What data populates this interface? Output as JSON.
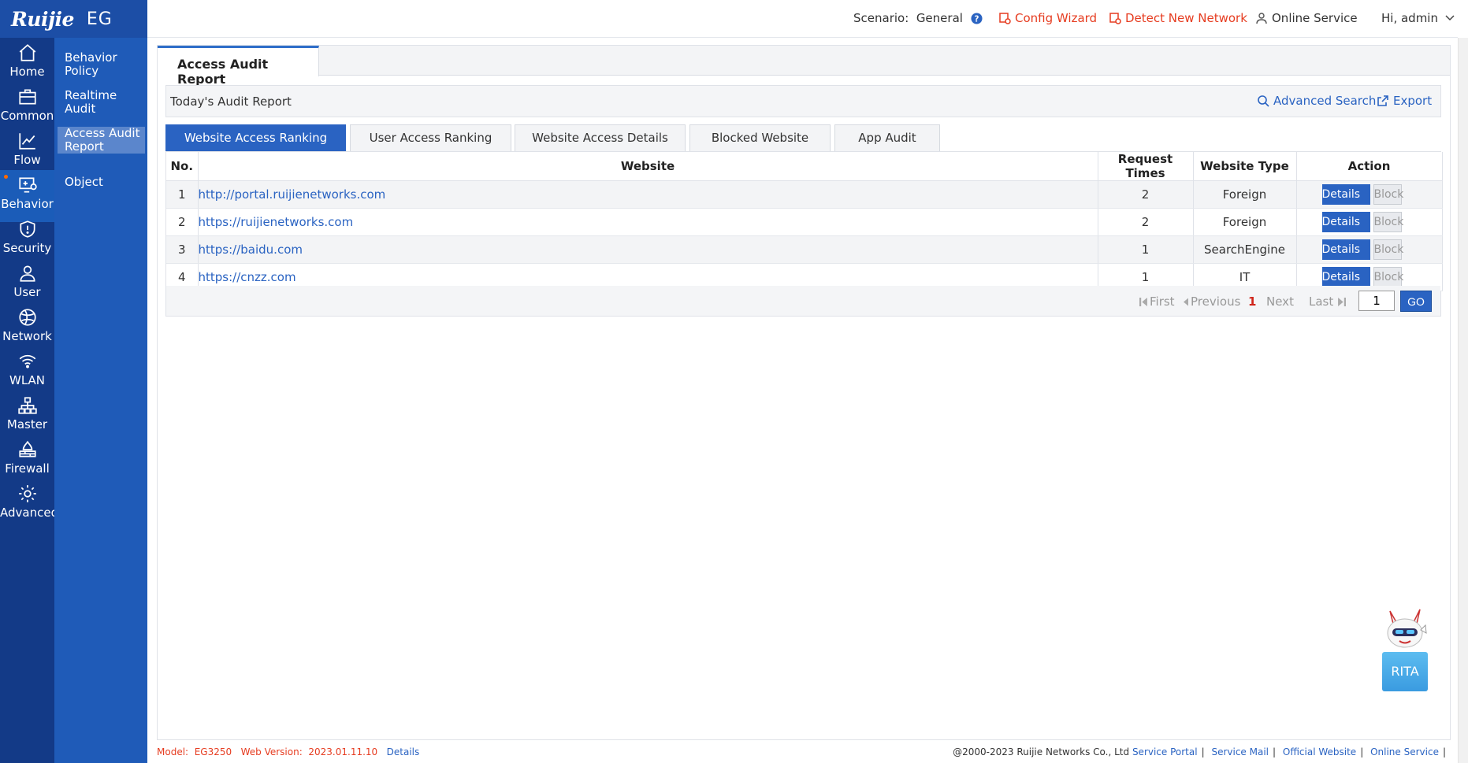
{
  "brand": {
    "logo": "Ruijie",
    "model": "EG"
  },
  "rail": [
    {
      "label": "Home",
      "icon": "home-icon"
    },
    {
      "label": "Common",
      "icon": "toolbox-icon"
    },
    {
      "label": "Flow",
      "icon": "chart-line-icon"
    },
    {
      "label": "Behavior",
      "icon": "monitor-person-icon"
    },
    {
      "label": "Security",
      "icon": "shield-icon"
    },
    {
      "label": "User",
      "icon": "user-icon"
    },
    {
      "label": "Network",
      "icon": "globe-icon"
    },
    {
      "label": "WLAN",
      "icon": "wifi-icon"
    },
    {
      "label": "Master",
      "icon": "hierarchy-icon"
    },
    {
      "label": "Firewall",
      "icon": "firewall-icon"
    },
    {
      "label": "Advanced",
      "icon": "gear-icon"
    }
  ],
  "submenu": [
    {
      "label": "Behavior Policy"
    },
    {
      "label": "Realtime Audit"
    },
    {
      "label": "Access Audit Report"
    },
    {
      "label": "Object"
    }
  ],
  "topbar": {
    "scenario_label": "Scenario:",
    "scenario_value": "General",
    "config_wizard": "Config Wizard",
    "detect_network": "Detect New Network",
    "online_service": "Online Service",
    "user_greeting": "Hi, admin"
  },
  "main_tab": "Access Audit Report",
  "report": {
    "title": "Today's Audit Report",
    "advanced_search": "Advanced Search",
    "export": "Export"
  },
  "subtabs": [
    {
      "label": "Website Access Ranking"
    },
    {
      "label": "User Access Ranking"
    },
    {
      "label": "Website Access Details"
    },
    {
      "label": "Blocked Website"
    },
    {
      "label": "App Audit"
    }
  ],
  "table": {
    "headers": {
      "no": "No.",
      "website": "Website",
      "requests": "Request Times",
      "type": "Website Type",
      "action": "Action"
    },
    "rows": [
      {
        "no": "1",
        "website": "http://portal.ruijienetworks.com",
        "requests": "2",
        "type": "Foreign"
      },
      {
        "no": "2",
        "website": "https://ruijienetworks.com",
        "requests": "2",
        "type": "Foreign"
      },
      {
        "no": "3",
        "website": "https://baidu.com",
        "requests": "1",
        "type": "SearchEngine"
      },
      {
        "no": "4",
        "website": "https://cnzz.com",
        "requests": "1",
        "type": "IT"
      }
    ],
    "details_label": "Details",
    "block_label": "Block"
  },
  "pager": {
    "first": "First",
    "previous": "Previous",
    "current": "1",
    "next": "Next",
    "last": "Last",
    "input_value": "1",
    "go": "GO"
  },
  "assistant": {
    "label": "RITA"
  },
  "footer": {
    "model_label": "Model:",
    "model_value": "EG3250",
    "version_label": "Web Version:",
    "version_value": "2023.01.11.10",
    "details": "Details",
    "copyright": "@2000-2023 Ruijie Networks Co., Ltd",
    "service_portal": "Service Portal",
    "service_mail": "Service Mail",
    "official_website": "Official Website",
    "online_service": "Online Service"
  },
  "colors": {
    "rail": "#133a87",
    "submenu": "#1f5bb8",
    "accent": "#2a63c2",
    "alert": "#e63c20"
  }
}
